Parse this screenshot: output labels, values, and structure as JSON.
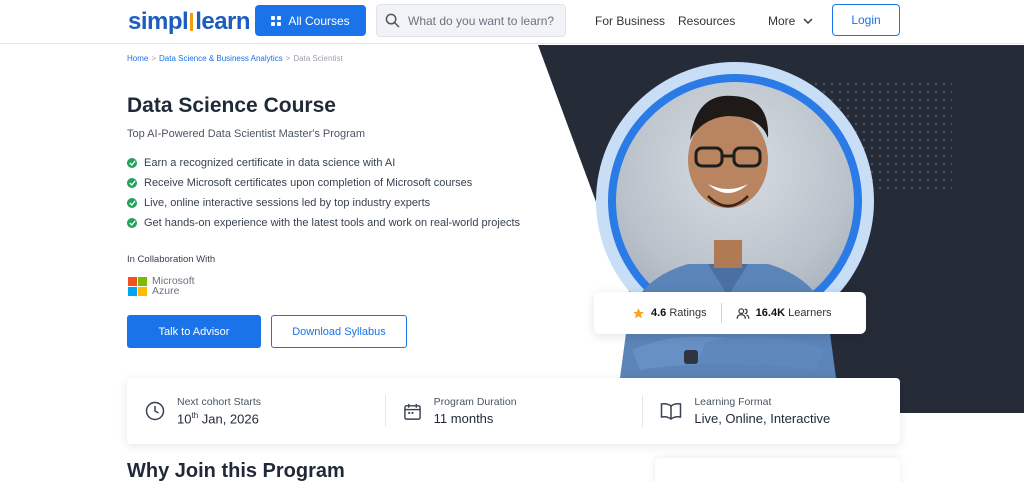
{
  "header": {
    "logo_text_a": "simpl",
    "logo_text_b": "learn",
    "all_courses": "All Courses",
    "search_placeholder": "What do you want to learn?",
    "nav": {
      "business": "For Business",
      "resources": "Resources",
      "more": "More"
    },
    "login": "Login"
  },
  "breadcrumb": {
    "home": "Home",
    "category": "Data Science & Business Analytics",
    "current": "Data Scientist",
    "separator": ">"
  },
  "hero": {
    "title": "Data Science Course",
    "subtitle": "Top AI-Powered Data Scientist Master's Program",
    "features": [
      "Earn a recognized certificate in data science with AI",
      "Receive Microsoft certificates upon completion of Microsoft courses",
      "Live, online interactive sessions led by top industry experts",
      "Get hands-on experience with the latest tools and work on real-world projects"
    ],
    "collab_label": "In Collaboration With",
    "partner_line1": "Microsoft",
    "partner_line2": "Azure",
    "cta_primary": "Talk to Advisor",
    "cta_secondary": "Download Syllabus"
  },
  "stats": {
    "rating_value": "4.6",
    "rating_label": "Ratings",
    "learners_value": "16.4K",
    "learners_label": "Learners"
  },
  "info": {
    "cohort_label": "Next cohort Starts",
    "cohort_day": "10",
    "cohort_suffix": "th",
    "cohort_rest": " Jan, 2026",
    "duration_label": "Program Duration",
    "duration_value": "11 months",
    "format_label": "Learning Format",
    "format_value": "Live, Online, Interactive"
  },
  "section_title": "Why Join this Program",
  "colors": {
    "primary": "#1a73e8",
    "dark_panel": "#262b38",
    "check_green": "#22a35a",
    "star": "#f5a623",
    "logo_orange": "#f59e0b"
  }
}
